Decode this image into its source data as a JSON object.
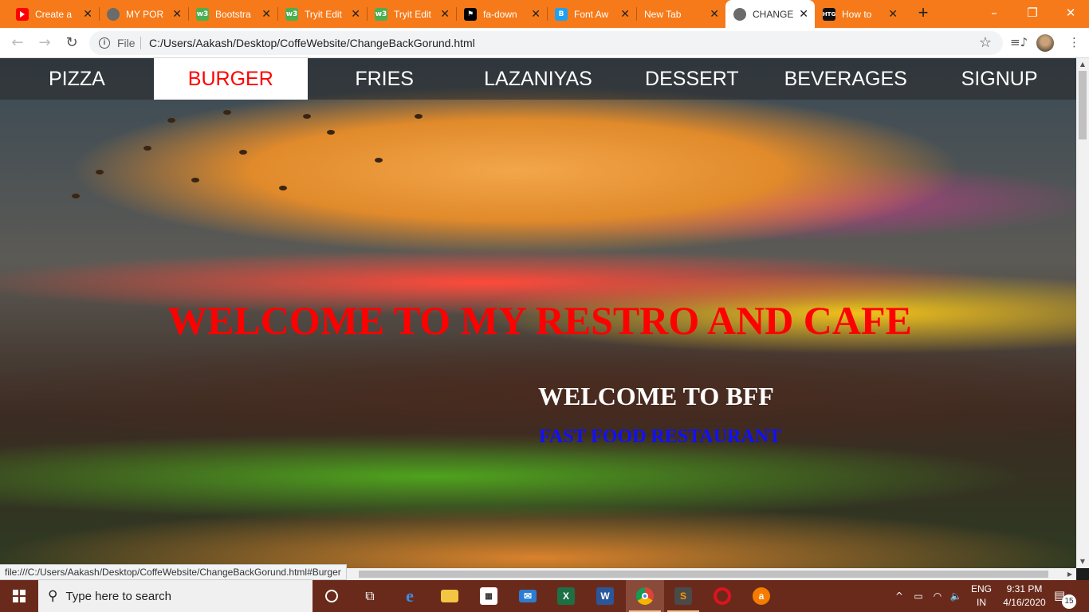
{
  "browser": {
    "tabs": [
      {
        "title": "Create a",
        "favicon": "youtube-icon"
      },
      {
        "title": "MY POR",
        "favicon": "globe-icon"
      },
      {
        "title": "Bootstra",
        "favicon": "w3schools-icon"
      },
      {
        "title": "Tryit Edit",
        "favicon": "w3schools-icon"
      },
      {
        "title": "Tryit Edit",
        "favicon": "w3schools-icon"
      },
      {
        "title": "fa-down",
        "favicon": "flag-icon"
      },
      {
        "title": "Font Aw",
        "favicon": "bootstrap-icon"
      },
      {
        "title": "New Tab",
        "favicon": ""
      },
      {
        "title": "CHANGE",
        "favicon": "globe-icon",
        "active": true
      },
      {
        "title": "How to",
        "favicon": "htg-icon"
      }
    ],
    "new_tab": "+",
    "window_controls": {
      "minimize": "–",
      "restore": "❐",
      "close": "✕"
    },
    "toolbar": {
      "back": "←",
      "forward": "→",
      "reload": "↻",
      "scheme_label": "File",
      "url": "C:/Users/Aakash/Desktop/CoffeWebsite/ChangeBackGorund.html",
      "star": "☆",
      "media": "≡♪",
      "menu": "⋮"
    },
    "status_url": "file:///C:/Users/Aakash/Desktop/CoffeWebsite/ChangeBackGorund.html#Burger"
  },
  "page": {
    "nav": [
      {
        "label": "PIZZA",
        "active": false
      },
      {
        "label": "BURGER",
        "active": true
      },
      {
        "label": "FRIES",
        "active": false
      },
      {
        "label": "LAZANIYAS",
        "active": false
      },
      {
        "label": "DESSERT",
        "active": false
      },
      {
        "label": "BEVERAGES",
        "active": false
      },
      {
        "label": "SIGNUP",
        "active": false
      }
    ],
    "heading": "WELCOME TO MY RESTRO AND CAFE",
    "subheading": "WELCOME TO BFF",
    "tagline": "FAST FOOD RESTAURANT",
    "colors": {
      "heading": "#ff0000",
      "subheading": "#ffffff",
      "tagline": "#1010ff",
      "nav_active_text": "#ff0000"
    }
  },
  "taskbar": {
    "search_placeholder": "Type here to search",
    "apps": [
      "cortana-icon",
      "task-view-icon",
      "edge-icon",
      "file-explorer-icon",
      "store-icon",
      "mail-icon",
      "excel-icon",
      "word-icon",
      "chrome-icon",
      "sublime-icon",
      "opera-icon",
      "avast-icon"
    ],
    "tray": {
      "chevron": "^",
      "lang_line1": "ENG",
      "lang_line2": "IN",
      "time": "9:31 PM",
      "date": "4/16/2020",
      "notifications": "15"
    }
  },
  "colors": {
    "tabstrip": "#f67a19",
    "taskbar": "#6a2a1b"
  }
}
